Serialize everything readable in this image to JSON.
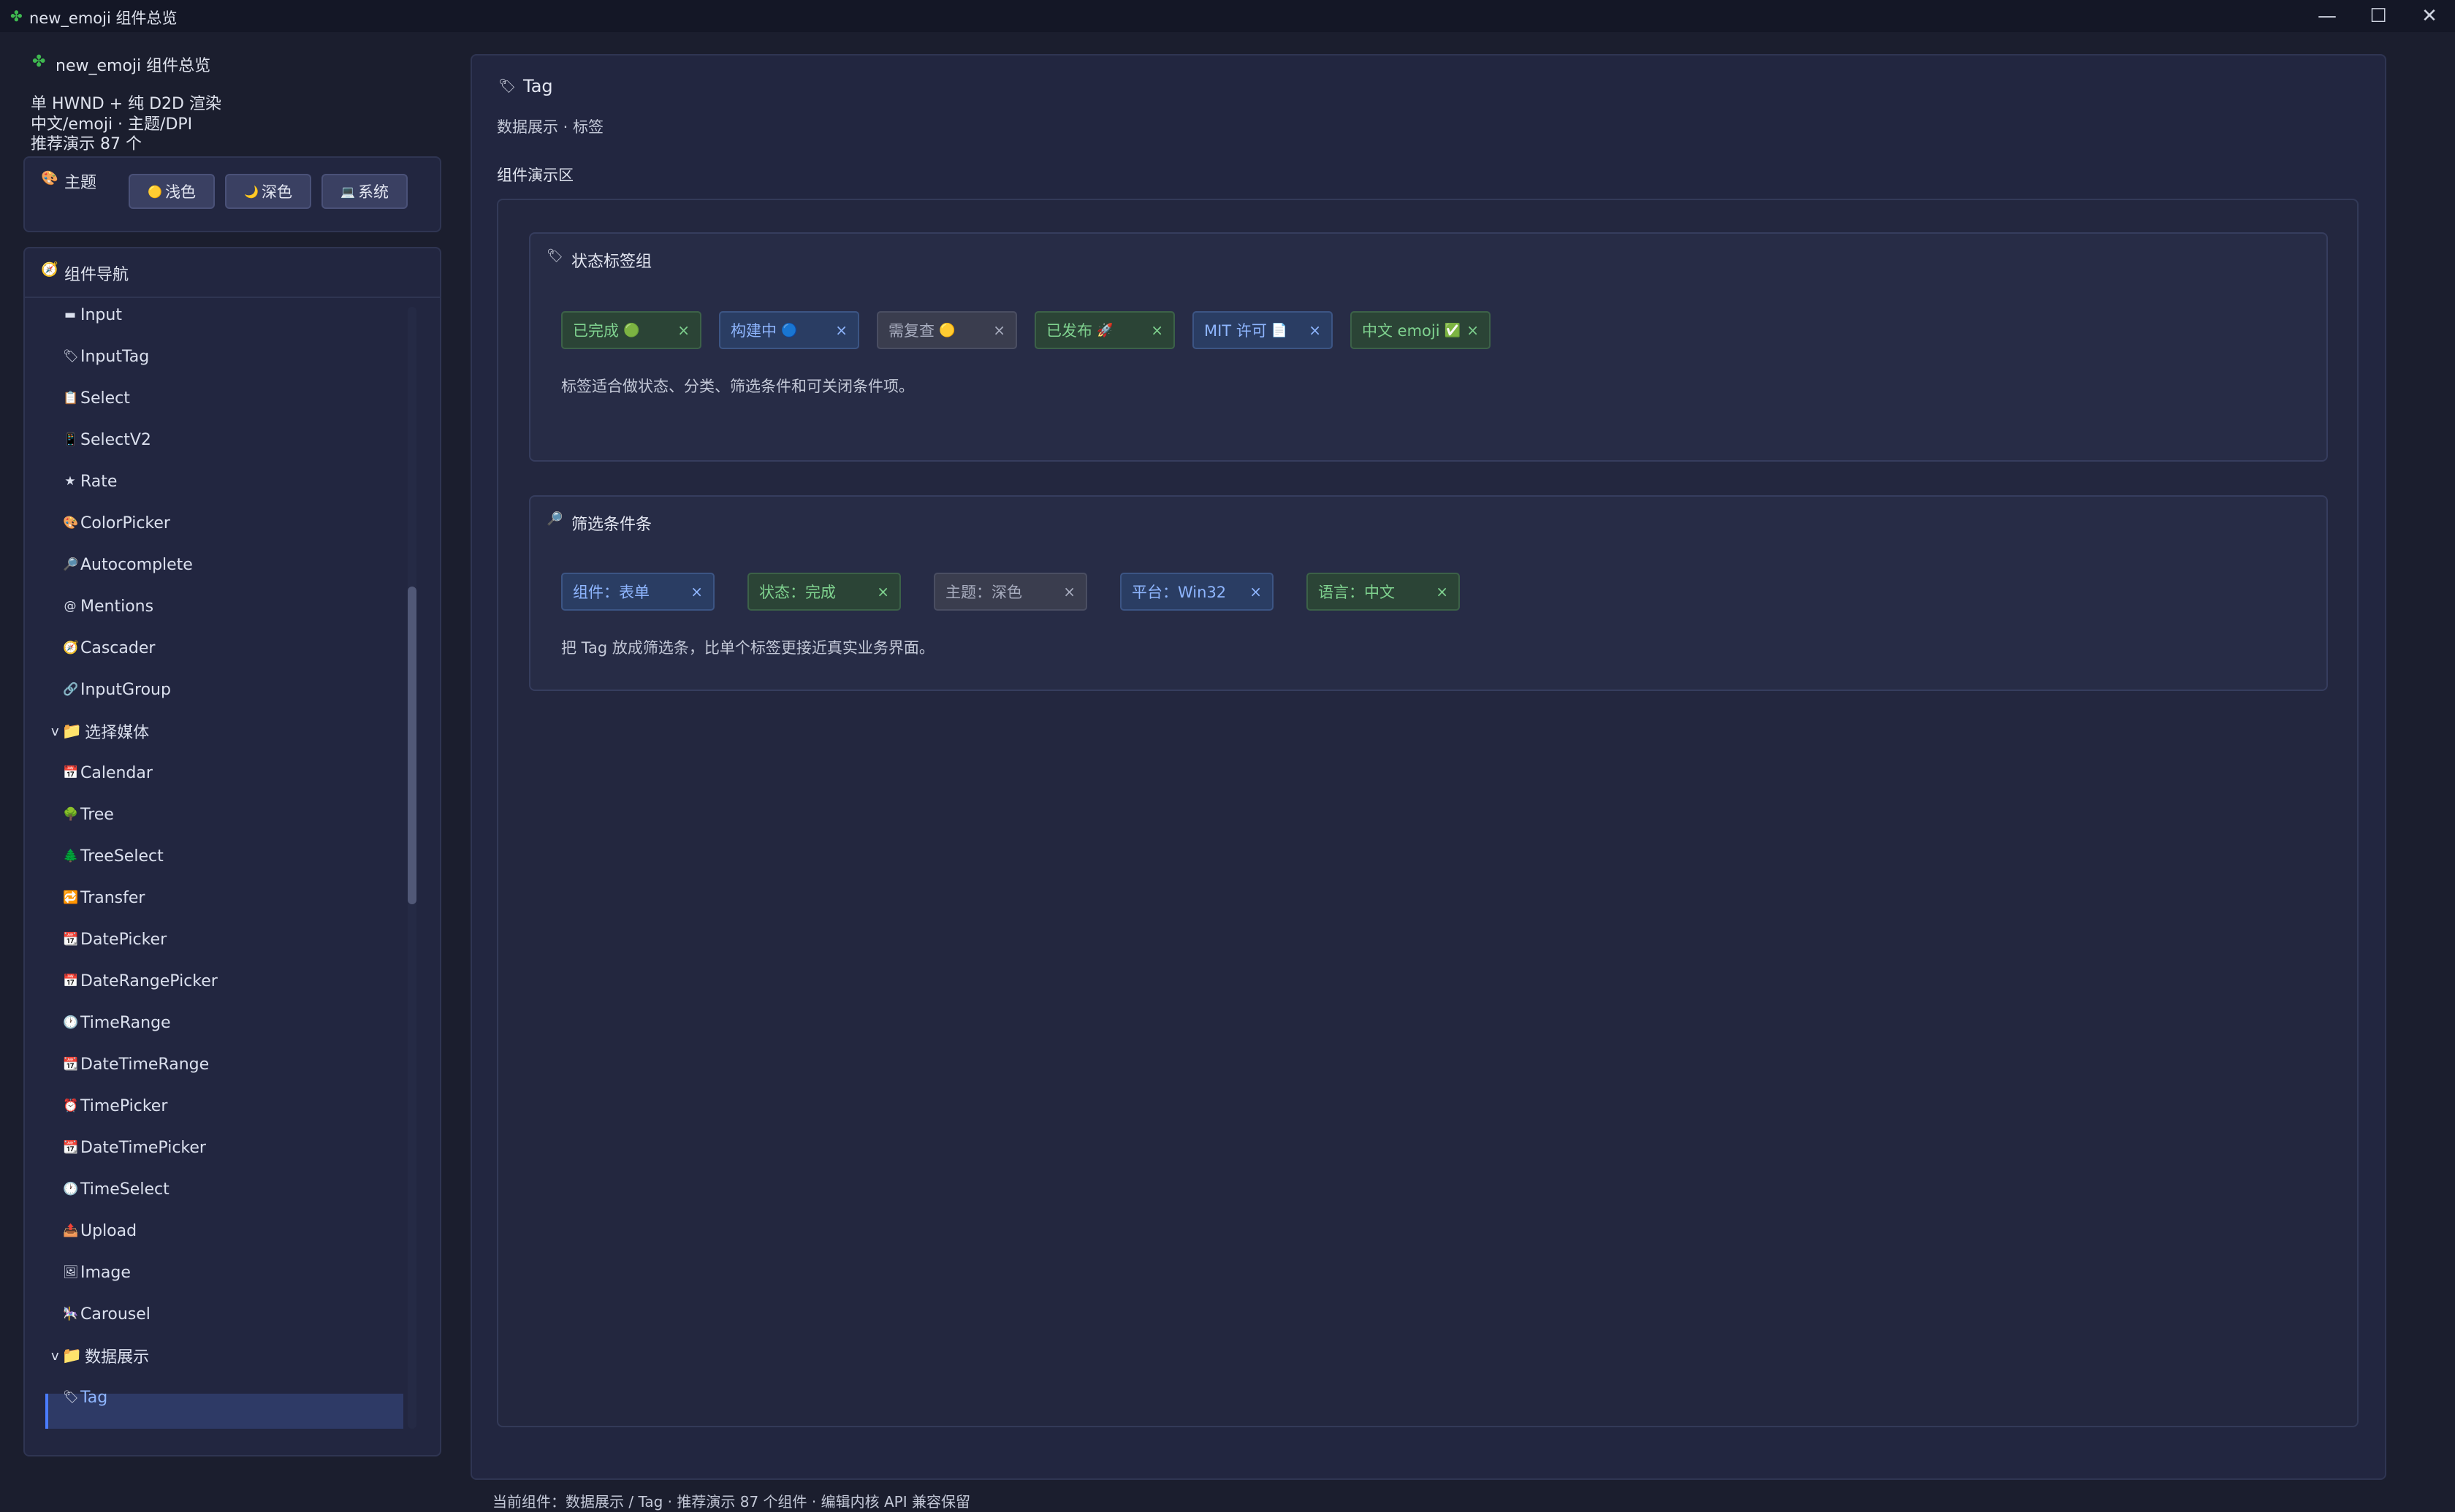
{
  "window": {
    "title": "new_emoji 组件总览",
    "icon": "puzzle-icon"
  },
  "sidebar": {
    "app_title": "new_emoji 组件总览",
    "info_lines": [
      "单 HWND + 纯 D2D 渲染",
      "中文/emoji · 主题/DPI",
      "推荐演示 87 个"
    ],
    "theme": {
      "label": "主题",
      "buttons": [
        {
          "icon": "🟡",
          "label": "浅色"
        },
        {
          "icon": "🌙",
          "label": "深色"
        },
        {
          "icon": "💻",
          "label": "系统"
        }
      ]
    },
    "nav_title": "组件导航",
    "nav_items": [
      {
        "icon": "▬",
        "label": "Input"
      },
      {
        "icon": "🏷",
        "label": "InputTag"
      },
      {
        "icon": "📋",
        "label": "Select"
      },
      {
        "icon": "📱",
        "label": "SelectV2"
      },
      {
        "icon": "★",
        "label": "Rate"
      },
      {
        "icon": "🎨",
        "label": "ColorPicker"
      },
      {
        "icon": "🔎",
        "label": "Autocomplete"
      },
      {
        "icon": "@",
        "label": "Mentions"
      },
      {
        "icon": "🧭",
        "label": "Cascader"
      },
      {
        "icon": "🔗",
        "label": "InputGroup"
      },
      {
        "group": true,
        "chevron": "v",
        "icon": "📁",
        "label": "选择媒体"
      },
      {
        "icon": "📅",
        "label": "Calendar"
      },
      {
        "icon": "🌳",
        "label": "Tree"
      },
      {
        "icon": "🌲",
        "label": "TreeSelect"
      },
      {
        "icon": "🔁",
        "label": "Transfer"
      },
      {
        "icon": "📆",
        "label": "DatePicker"
      },
      {
        "icon": "📅",
        "label": "DateRangePicker"
      },
      {
        "icon": "🕐",
        "label": "TimeRange"
      },
      {
        "icon": "📆",
        "label": "DateTimeRange"
      },
      {
        "icon": "⏰",
        "label": "TimePicker"
      },
      {
        "icon": "📆",
        "label": "DateTimePicker"
      },
      {
        "icon": "🕐",
        "label": "TimeSelect"
      },
      {
        "icon": "📤",
        "label": "Upload"
      },
      {
        "icon": "🖼",
        "label": "Image"
      },
      {
        "icon": "🎠",
        "label": "Carousel"
      },
      {
        "group": true,
        "chevron": "v",
        "icon": "📁",
        "label": "数据展示"
      },
      {
        "icon": "🏷",
        "label": "Tag",
        "selected": true
      }
    ]
  },
  "main": {
    "title_icon": "🏷",
    "title": "Tag",
    "subtitle": "数据展示 · 标签",
    "demo_label": "组件演示区",
    "cards": [
      {
        "icon": "🏷",
        "title": "状态标签组",
        "tags": [
          {
            "label": "已完成",
            "emoji": "🟢",
            "style": "green",
            "close": "×"
          },
          {
            "label": "构建中",
            "emoji": "🔵",
            "style": "blue",
            "close": "×"
          },
          {
            "label": "需复查",
            "emoji": "🟡",
            "style": "gray",
            "close": "×"
          },
          {
            "label": "已发布",
            "emoji": "🚀",
            "style": "green",
            "close": "×"
          },
          {
            "label": "MIT 许可",
            "emoji": "📄",
            "style": "blue",
            "close": "×"
          },
          {
            "label": "中文 emoji",
            "emoji": "✅",
            "style": "green",
            "close": "×"
          }
        ],
        "description": "标签适合做状态、分类、筛选条件和可关闭条件项。"
      },
      {
        "icon": "🔎",
        "title": "筛选条件条",
        "tags": [
          {
            "label": "组件：表单",
            "style": "blue",
            "close": "×"
          },
          {
            "label": "状态：完成",
            "style": "green",
            "close": "×"
          },
          {
            "label": "主题：深色",
            "style": "gray",
            "close": "×"
          },
          {
            "label": "平台：Win32",
            "style": "blue",
            "close": "×"
          },
          {
            "label": "语言：中文",
            "style": "green",
            "close": "×"
          }
        ],
        "description": "把 Tag 放成筛选条，比单个标签更接近真实业务界面。"
      }
    ]
  },
  "status_bar": "当前组件：数据展示 / Tag · 推荐演示 87 个组件 · 编辑内核 API 兼容保留",
  "colors": {
    "background": "#1b1e2e",
    "accent": "#4a7cff",
    "tag_green": "#7fd28f",
    "tag_blue": "#8fb6ff",
    "tag_gray": "#a8adbf"
  }
}
